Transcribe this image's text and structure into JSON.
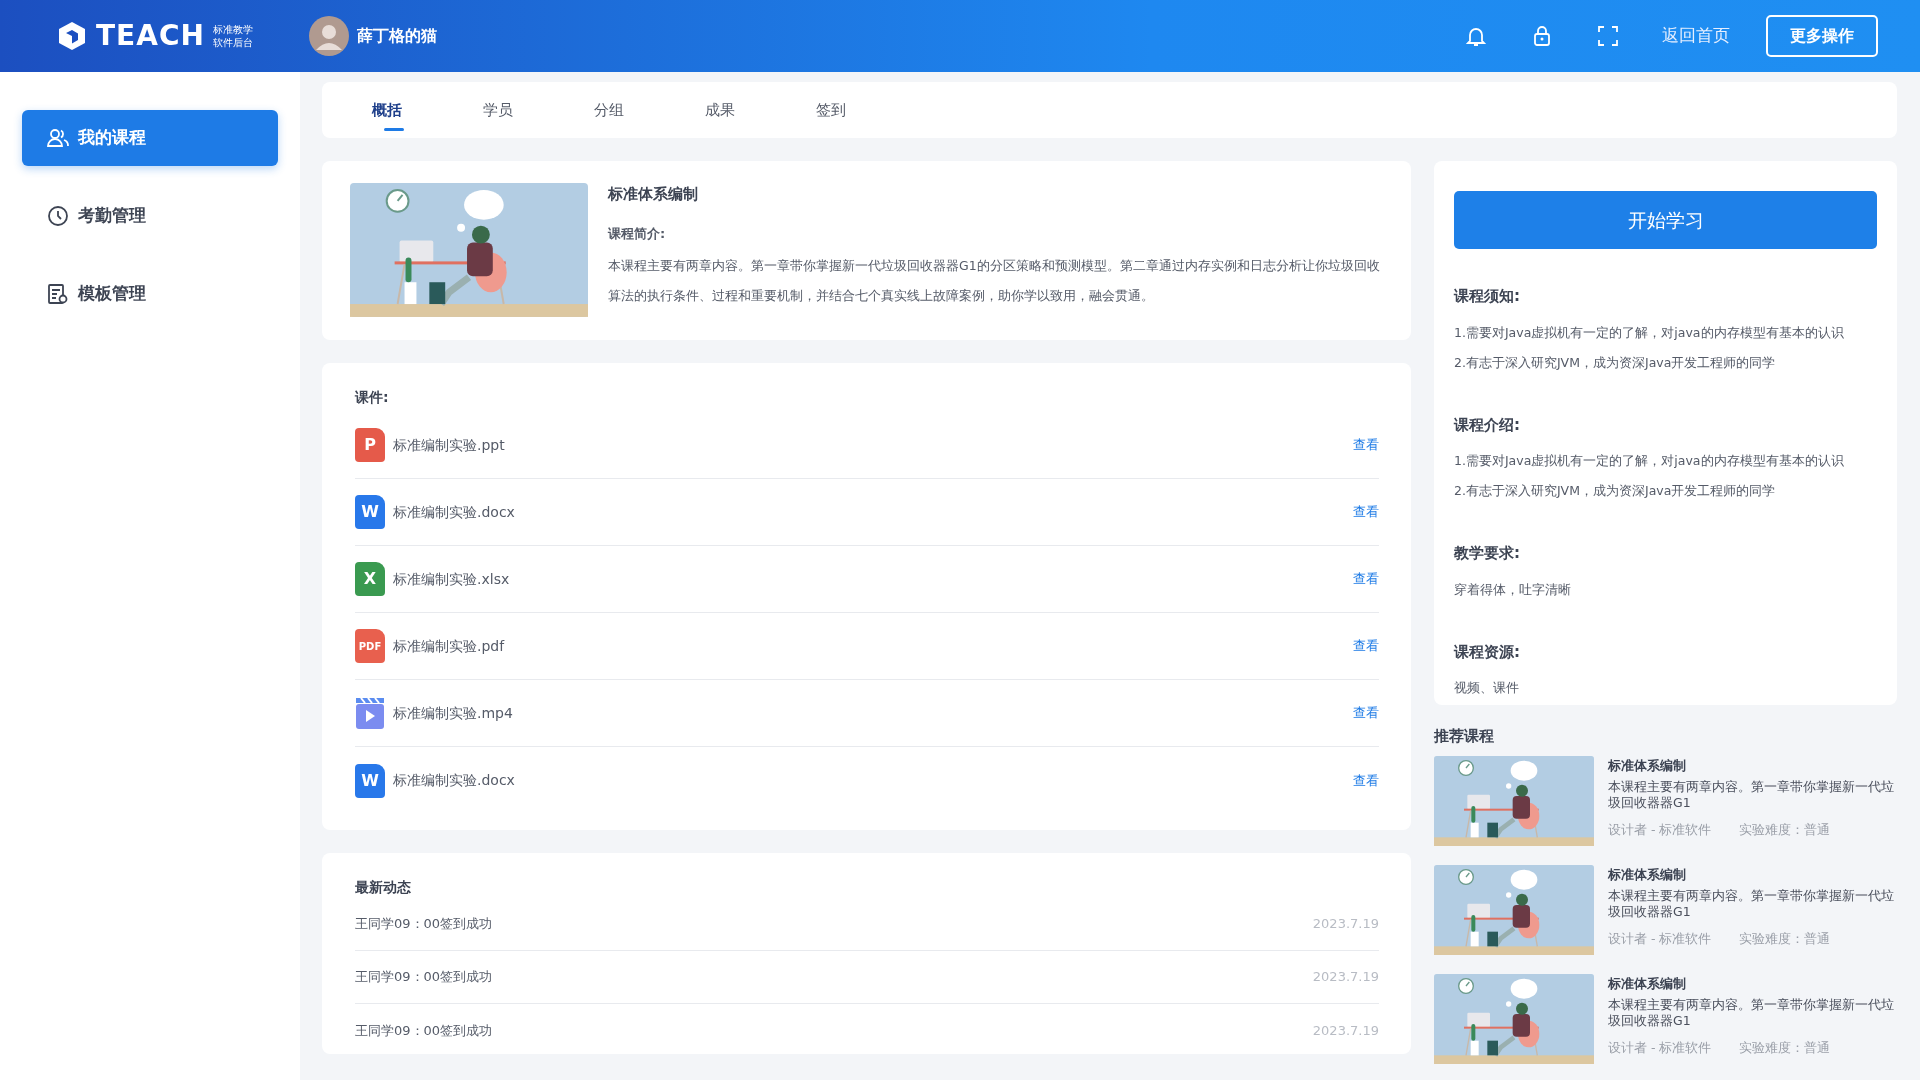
{
  "header": {
    "logo_text": "TEACH",
    "logo_subtitle": [
      "标准教学",
      "软件后台"
    ],
    "user_name": "薛丁格的猫",
    "home_link": "返回首页",
    "more_button": "更多操作"
  },
  "sidebar": {
    "items": [
      {
        "label": "我的课程",
        "kind": "people",
        "selected": true
      },
      {
        "label": "考勤管理",
        "kind": "clock",
        "selected": false
      },
      {
        "label": "模板管理",
        "kind": "document",
        "selected": false
      }
    ]
  },
  "tabs": [
    {
      "label": "概括",
      "selected": true
    },
    {
      "label": "学员",
      "selected": false
    },
    {
      "label": "分组",
      "selected": false
    },
    {
      "label": "成果",
      "selected": false
    },
    {
      "label": "签到",
      "selected": false
    }
  ],
  "course": {
    "title": "标准体系编制",
    "intro_label": "课程简介:",
    "intro": "本课程主要有两章内容。第一章带你掌握新一代垃圾回收器器G1的分区策略和预测模型。第二章通过内存实例和日志分析让你垃圾回收算法的执行条件、过程和重要机制，并结合七个真实线上故障案例，助你学以致用，融会贯通。"
  },
  "files": {
    "title": "课件:",
    "items": [
      {
        "name": "标准编制实验.ppt",
        "kind": "ppt",
        "badge": "P",
        "action": "查看"
      },
      {
        "name": "标准编制实验.docx",
        "kind": "word",
        "badge": "W",
        "action": "查看"
      },
      {
        "name": "标准编制实验.xlsx",
        "kind": "excel",
        "badge": "X",
        "action": "查看"
      },
      {
        "name": "标准编制实验.pdf",
        "kind": "pdf",
        "badge": "PDF",
        "action": "查看"
      },
      {
        "name": "标准编制实验.mp4",
        "kind": "video",
        "action": "查看"
      },
      {
        "name": "标准编制实验.docx",
        "kind": "word",
        "badge": "W",
        "action": "查看"
      }
    ]
  },
  "news": {
    "title": "最新动态",
    "items": [
      {
        "text": "王同学09：00签到成功",
        "date": "2023.7.19"
      },
      {
        "text": "王同学09：00签到成功",
        "date": "2023.7.19"
      },
      {
        "text": "王同学09：00签到成功",
        "date": "2023.7.19"
      }
    ]
  },
  "info": {
    "button": "开始学习",
    "sections": [
      {
        "heading": "课程须知:",
        "lines": [
          "1.需要对Java虚拟机有一定的了解，对java的内存模型有基本的认识",
          "2.有志于深入研究JVM，成为资深Java开发工程师的同学"
        ]
      },
      {
        "heading": "课程介绍:",
        "lines": [
          "1.需要对Java虚拟机有一定的了解，对java的内存模型有基本的认识",
          "2.有志于深入研究JVM，成为资深Java开发工程师的同学"
        ]
      },
      {
        "heading": "教学要求:",
        "lines": [
          "穿着得体，吐字清晰"
        ]
      },
      {
        "heading": "课程资源:",
        "lines": [
          "视频、课件"
        ]
      }
    ]
  },
  "recommended": {
    "title": "推荐课程",
    "items": [
      {
        "title": "标准体系编制",
        "desc": "本课程主要有两章内容。第一章带你掌握新一代垃圾回收器器G1",
        "designer": "设计者 - 标准软件",
        "difficulty": "实验难度：普通"
      },
      {
        "title": "标准体系编制",
        "desc": "本课程主要有两章内容。第一章带你掌握新一代垃圾回收器器G1",
        "designer": "设计者 - 标准软件",
        "difficulty": "实验难度：普通"
      },
      {
        "title": "标准体系编制",
        "desc": "本课程主要有两章内容。第一章带你掌握新一代垃圾回收器器G1",
        "designer": "设计者 - 标准软件",
        "difficulty": "实验难度：普通"
      }
    ]
  }
}
